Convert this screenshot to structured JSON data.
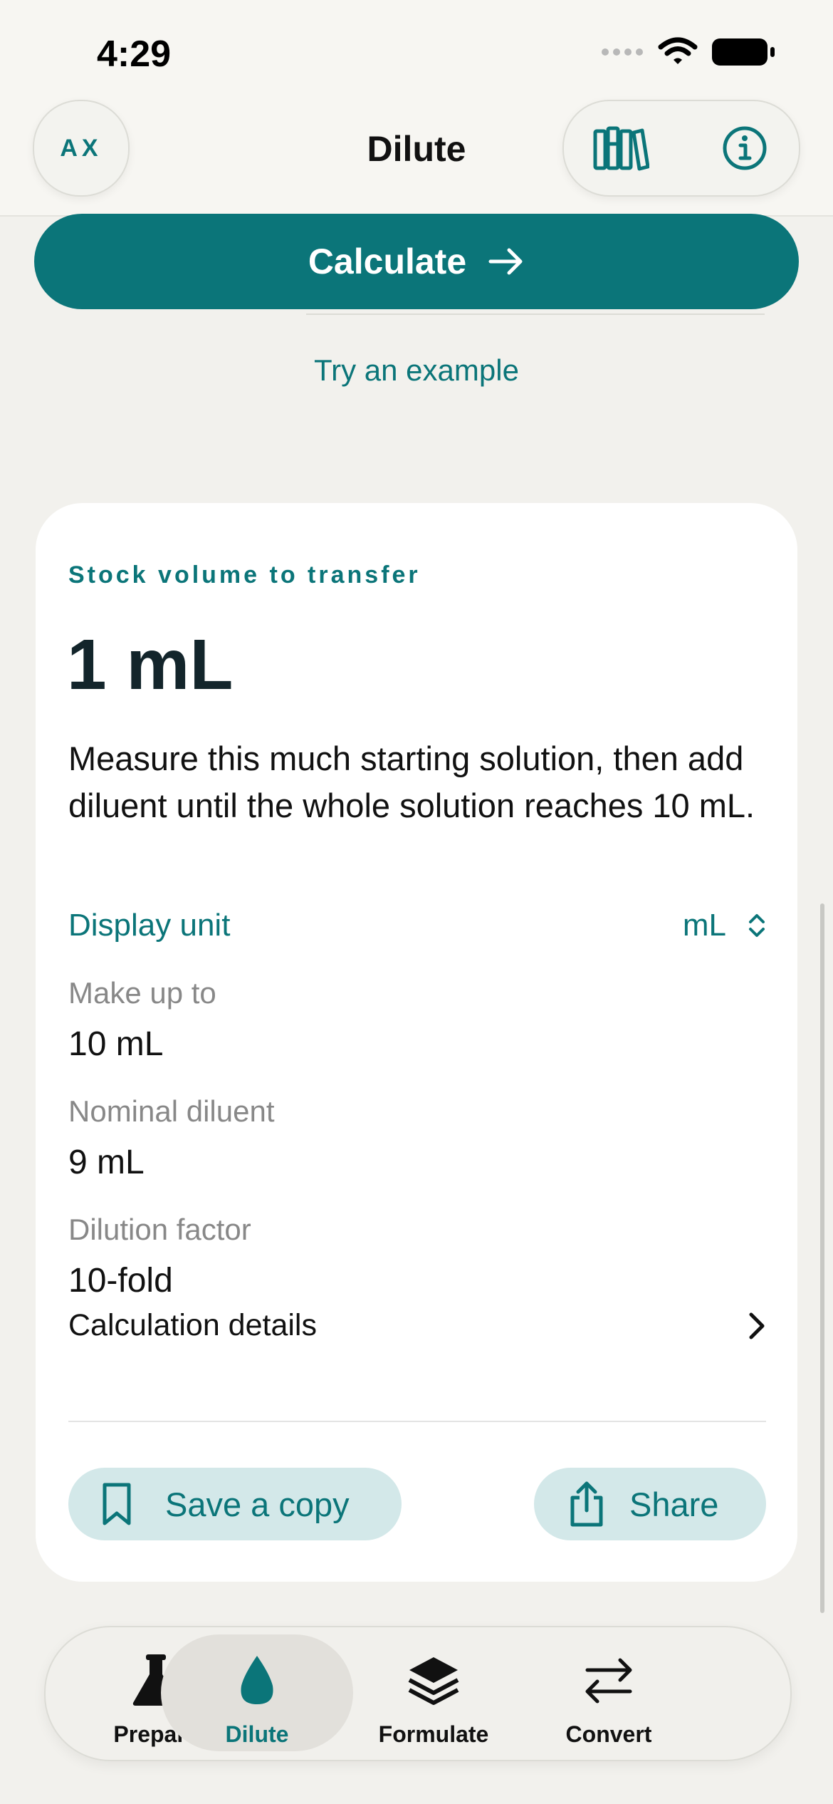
{
  "status_bar": {
    "time": "4:29"
  },
  "header": {
    "avatar_initials": "AX",
    "title": "Dilute"
  },
  "actions": {
    "calculate_label": "Calculate",
    "example_link": "Try an example"
  },
  "result": {
    "eyebrow": "Stock volume to transfer",
    "value": "1 mL",
    "description": "Measure this much starting solution, then add diluent until the whole solution reaches 10 mL.",
    "display_unit_label": "Display unit",
    "display_unit_value": "mL",
    "fields": [
      {
        "label": "Make up to",
        "value": "10 mL"
      },
      {
        "label": "Nominal diluent",
        "value": "9 mL"
      },
      {
        "label": "Dilution factor",
        "value": "10-fold"
      }
    ],
    "details_label": "Calculation details",
    "save_label": "Save a copy",
    "share_label": "Share"
  },
  "tabs": [
    {
      "label": "Prepare",
      "icon": "flask-icon"
    },
    {
      "label": "Dilute",
      "icon": "drop-icon"
    },
    {
      "label": "Formulate",
      "icon": "layers-icon"
    },
    {
      "label": "Convert",
      "icon": "arrows-icon"
    }
  ],
  "colors": {
    "accent": "#0b7579",
    "accent_light": "#d3e8e9",
    "background": "#f2f1ed"
  }
}
